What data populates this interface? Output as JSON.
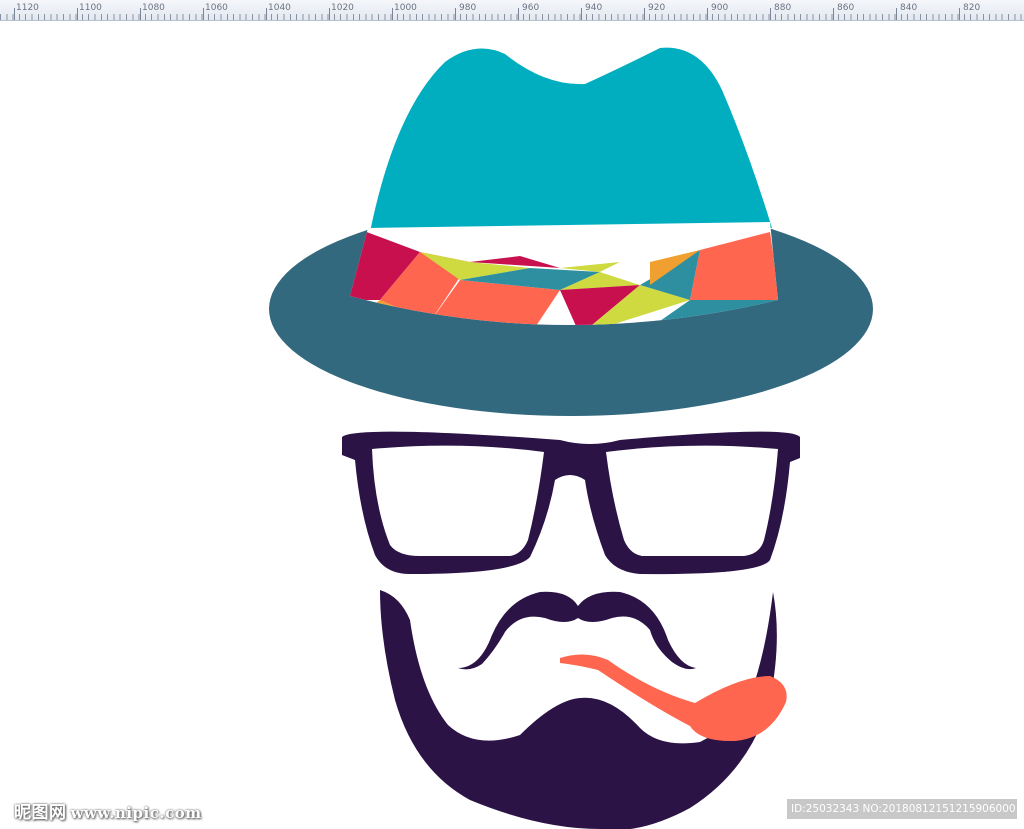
{
  "ruler": {
    "labels": [
      "1120",
      "1100",
      "1080",
      "1060",
      "1040",
      "1020",
      "1000",
      "980",
      "960",
      "940",
      "920",
      "900",
      "880",
      "860",
      "840",
      "820"
    ]
  },
  "illustration": {
    "hat_crown_color": "#00aebf",
    "hat_brim_color": "#33697e",
    "band_colors": [
      "#c8104f",
      "#ff6650",
      "#cfd940",
      "#2e8fa0",
      "#f0a030",
      "#ffffff"
    ],
    "glasses_color": "#2b1346",
    "beard_color": "#2b1346",
    "pipe_color": "#ff6650"
  },
  "watermark": {
    "site_name": "昵图网",
    "site_url": "www.nipic.com",
    "id_text": "ID:25032343 NO:20180812151215906000"
  }
}
